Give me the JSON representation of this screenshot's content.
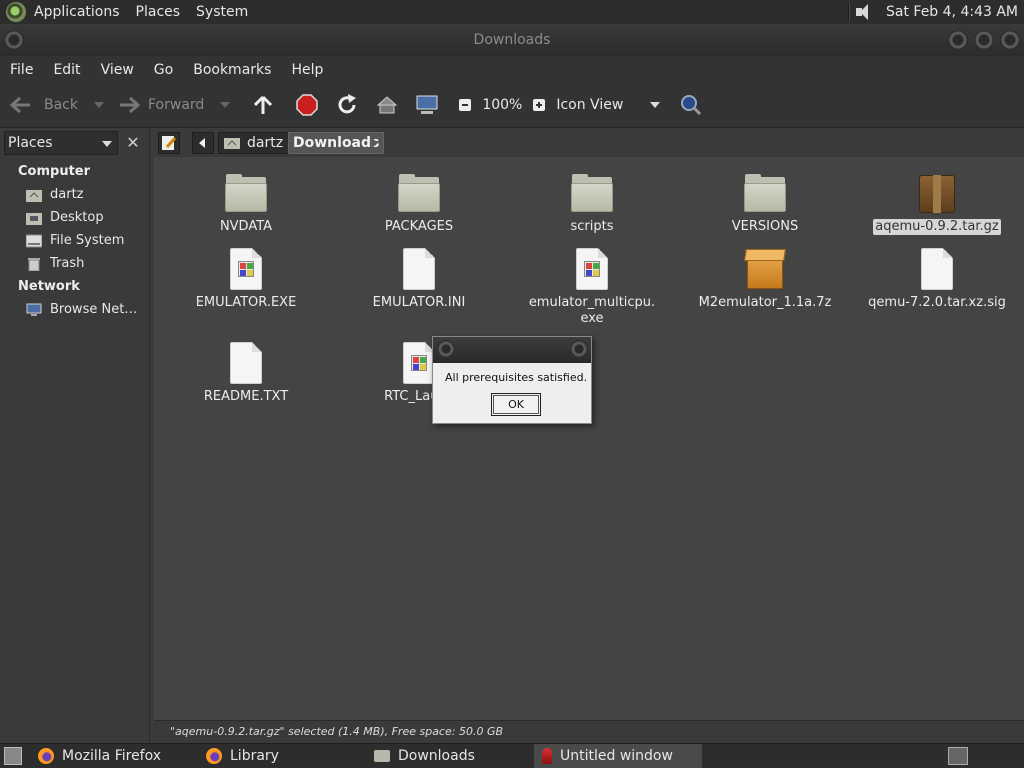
{
  "top_panel": {
    "menus": [
      "Applications",
      "Places",
      "System"
    ],
    "clock": "Sat Feb  4,  4:43 AM"
  },
  "window": {
    "title": "Downloads"
  },
  "menubar": [
    "File",
    "Edit",
    "View",
    "Go",
    "Bookmarks",
    "Help"
  ],
  "toolbar": {
    "back_label": "Back",
    "forward_label": "Forward",
    "zoom_level": "100%",
    "view_mode": "Icon View"
  },
  "sidebar": {
    "selector_label": "Places",
    "sections": [
      {
        "header": "Computer",
        "items": [
          "dartz",
          "Desktop",
          "File System",
          "Trash"
        ]
      },
      {
        "header": "Network",
        "items": [
          "Browse Net…"
        ]
      }
    ]
  },
  "location": {
    "crumbs": [
      "dartz",
      "Downloads"
    ]
  },
  "files": [
    {
      "name": "NVDATA",
      "type": "folder"
    },
    {
      "name": "PACKAGES",
      "type": "folder"
    },
    {
      "name": "scripts",
      "type": "folder"
    },
    {
      "name": "VERSIONS",
      "type": "folder"
    },
    {
      "name": "aqemu-0.9.2.tar.gz",
      "type": "archive",
      "selected": true
    },
    {
      "name": "EMULATOR.EXE",
      "type": "exe"
    },
    {
      "name": "EMULATOR.INI",
      "type": "doc"
    },
    {
      "name": "emulator_multicpu.\nexe",
      "type": "exe"
    },
    {
      "name": "M2emulator_1.1a.7z",
      "type": "box"
    },
    {
      "name": "qemu-7.2.0.tar.xz.sig",
      "type": "doc"
    },
    {
      "name": "README.TXT",
      "type": "doc"
    },
    {
      "name": "RTC_Launc",
      "type": "exe"
    }
  ],
  "dialog": {
    "message": "All prerequisites satisfied.",
    "ok_label": "OK"
  },
  "status": "\"aqemu-0.9.2.tar.gz\" selected (1.4 MB), Free space: 50.0 GB",
  "taskbar": [
    {
      "label": "Mozilla Firefox",
      "icon": "firefox-icon"
    },
    {
      "label": "Library",
      "icon": "firefox-icon"
    },
    {
      "label": "Downloads",
      "icon": "folder-icon"
    },
    {
      "label": "Untitled window",
      "icon": "wine-icon",
      "active": true
    }
  ]
}
